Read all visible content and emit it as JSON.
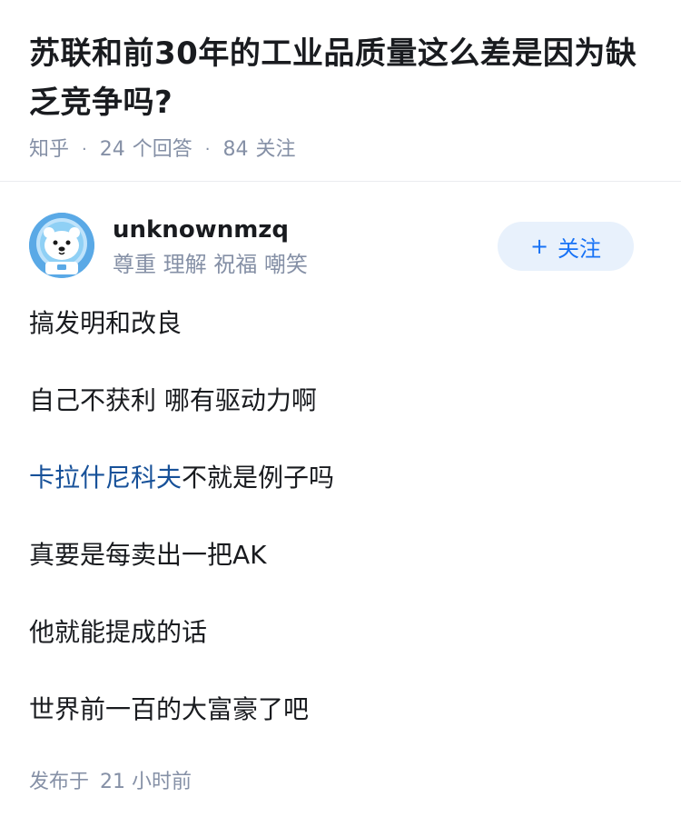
{
  "question": {
    "title": "苏联和前30年的工业品质量这么差是因为缺乏竞争吗?",
    "source": "知乎",
    "answer_count": "24",
    "answer_label": "个回答",
    "follow_count": "84",
    "follow_label": "关注"
  },
  "author": {
    "name": "unknownmzq",
    "bio": "尊重 理解 祝福 嘲笑",
    "follow_button_label": "关注",
    "follow_button_icon": "plus-icon",
    "avatar_icon": "polar-bear-astronaut-avatar"
  },
  "answer": {
    "paragraphs": [
      "搞发明和改良",
      "自己不获利 哪有驱动力啊",
      "",
      "真要是每卖出一把AK",
      "他就能提成的话",
      "世界前一百的大富豪了吧"
    ],
    "link_text": "卡拉什尼科夫",
    "link_suffix": "不就是例子吗",
    "posted_label": "发布于",
    "posted_time": "21 小时前"
  },
  "colors": {
    "link": "#175199",
    "accent": "#1772f6",
    "meta": "#8590a6",
    "follow_bg": "#e8f1fc"
  }
}
